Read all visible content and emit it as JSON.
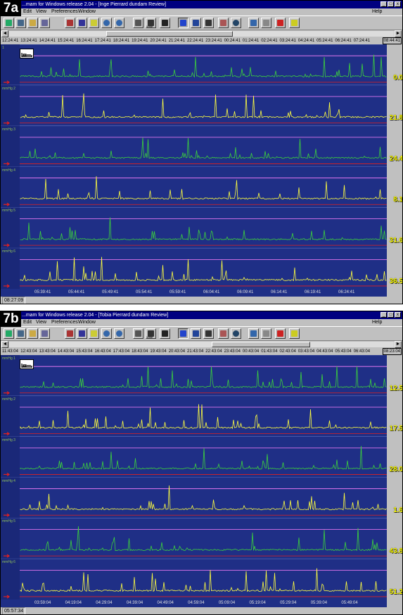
{
  "panels": [
    {
      "label": "7a",
      "title": "...mam for Windows release 2.04 - [Inge Pierrard dundam Review]",
      "menu": [
        "Edit",
        "View",
        "Preferences",
        "Window"
      ],
      "help": "Help",
      "time_ticks": [
        "12:24:41",
        "13:24:41",
        "14:24:41",
        "15:24:41",
        "16:24:41",
        "17:24:41",
        "18:24:41",
        "19:24:41",
        "20:24:41",
        "21:24:41",
        "22:24:41",
        "23:24:41",
        "00:24:41",
        "01:24:41",
        "02:24:41",
        "03:24:41",
        "04:24:41",
        "05:24:41",
        "06:24:41",
        "07:24:41"
      ],
      "time_end": "08:44:41",
      "bottom_ticks": [
        "05:39:41",
        "05:44:41",
        "05:49:41",
        "05:54:41",
        "05:59:41",
        "06:04:41",
        "06:09:41",
        "06:14:41",
        "06:19:41",
        "06:24:41"
      ],
      "clock": "08:27:09",
      "values": [
        "0.0",
        "21.8",
        "24.4",
        "8.1",
        "31.6",
        "36.5"
      ],
      "track_units": [
        "",
        "mmHg",
        "mmHg",
        "mmHg",
        "mmHg",
        "mmHg"
      ],
      "track_ids": [
        "1",
        "2",
        "3",
        "4",
        "5",
        "6"
      ],
      "colors": {
        "bg": "#1f2f86",
        "yellow": "#ffff40",
        "green": "#3cd23c",
        "red": "#e02020",
        "pink": "#ff80ff",
        "white": "#ffffff"
      },
      "track_colors": [
        "green",
        "yellow",
        "green",
        "yellow",
        "green",
        "yellow"
      ]
    },
    {
      "label": "7b",
      "title": "...mam for Windows release 2.04 - [Tobia Pierrard dundam Review]",
      "menu": [
        "Edit",
        "View",
        "Preferences",
        "Window"
      ],
      "help": "Help",
      "time_ticks": [
        "11:43:04",
        "12:43:04",
        "13:43:04",
        "14:43:04",
        "15:43:04",
        "16:43:04",
        "17:43:04",
        "18:43:04",
        "19:43:04",
        "20:43:04",
        "21:43:04",
        "22:43:04",
        "23:43:04",
        "00:43:04",
        "01:43:04",
        "02:43:04",
        "03:43:04",
        "04:43:04",
        "05:43:04",
        "06:43:04"
      ],
      "time_end": "08:23:04",
      "bottom_ticks": [
        "03:59:04",
        "04:19:04",
        "04:29:04",
        "04:39:04",
        "04:49:04",
        "04:59:04",
        "05:09:04",
        "05:19:04",
        "05:29:04",
        "05:39:04",
        "05:49:04"
      ],
      "clock": "05:57:34",
      "values": [
        "12.5",
        "17.5",
        "28.0",
        "1.6",
        "43.8",
        "51.2"
      ],
      "track_units": [
        "mmHg",
        "mmHg",
        "mmHg",
        "mmHg",
        "mmHg",
        "mmHg"
      ],
      "track_ids": [
        "1",
        "2",
        "3",
        "4",
        "5",
        "6"
      ],
      "colors": {
        "bg": "#1f2f86",
        "yellow": "#ffff40",
        "green": "#3cd23c",
        "red": "#e02020",
        "pink": "#ff80ff",
        "white": "#ffffff"
      },
      "track_colors": [
        "green",
        "yellow",
        "green",
        "yellow",
        "green",
        "yellow"
      ]
    }
  ],
  "toolbar_icons": [
    "open-icon",
    "print-icon",
    "save-icon",
    "network-icon",
    "book-icon",
    "filter-icon",
    "paint-icon",
    "zoom-in-icon",
    "zoom-out-icon",
    "printer-icon",
    "write-icon",
    "camera-icon",
    "pointer-icon",
    "probe-icon",
    "thermometer-icon",
    "ruler-icon",
    "magnifier-icon",
    "funnel-icon",
    "cup-icon",
    "cancel-icon",
    "note-icon"
  ],
  "write_label": "Write"
}
